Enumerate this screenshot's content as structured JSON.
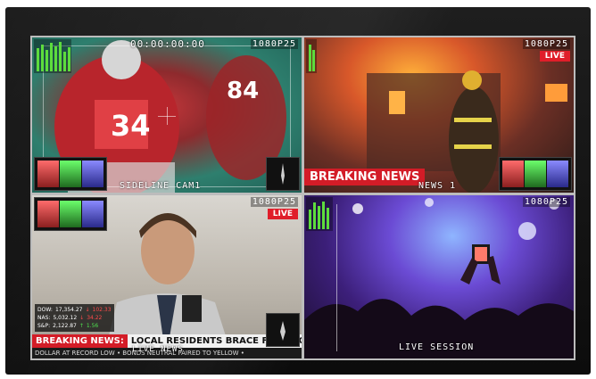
{
  "panes": {
    "sports": {
      "timecode": "00:00:00:00",
      "resolution": "1080P25",
      "caption": "SIDELINE CAM1"
    },
    "fire": {
      "resolution": "1080P25",
      "live_label": "LIVE",
      "breaking_label": "BREAKING NEWS",
      "caption": "NEWS 1"
    },
    "anchor": {
      "resolution": "1080P25",
      "live_label": "LIVE",
      "ticker_label": "BREAKING NEWS:",
      "ticker_headline": "LOCAL RESIDENTS BRACE FOR LOCAL",
      "ticker_secondary": "DOLLAR AT RECORD LOW • BONDS NEUTRAL PAIRED TO YELLOW •",
      "caption": "LIVE NEWS",
      "stocks": [
        {
          "name": "DOW:",
          "value": "17,354.27",
          "dir": "↓",
          "change": "102.33"
        },
        {
          "name": "NAS:",
          "value": "5,032.12",
          "dir": "↓",
          "change": "34.22"
        },
        {
          "name": "S&P:",
          "value": "2,122.87",
          "dir": "↑",
          "change": "1.56"
        }
      ]
    },
    "concert": {
      "resolution": "1080P25",
      "caption": "LIVE SESSION"
    }
  },
  "colors": {
    "live_red": "#e01e2a",
    "meter_green": "#5ddc3d",
    "bezel": "#141414"
  }
}
